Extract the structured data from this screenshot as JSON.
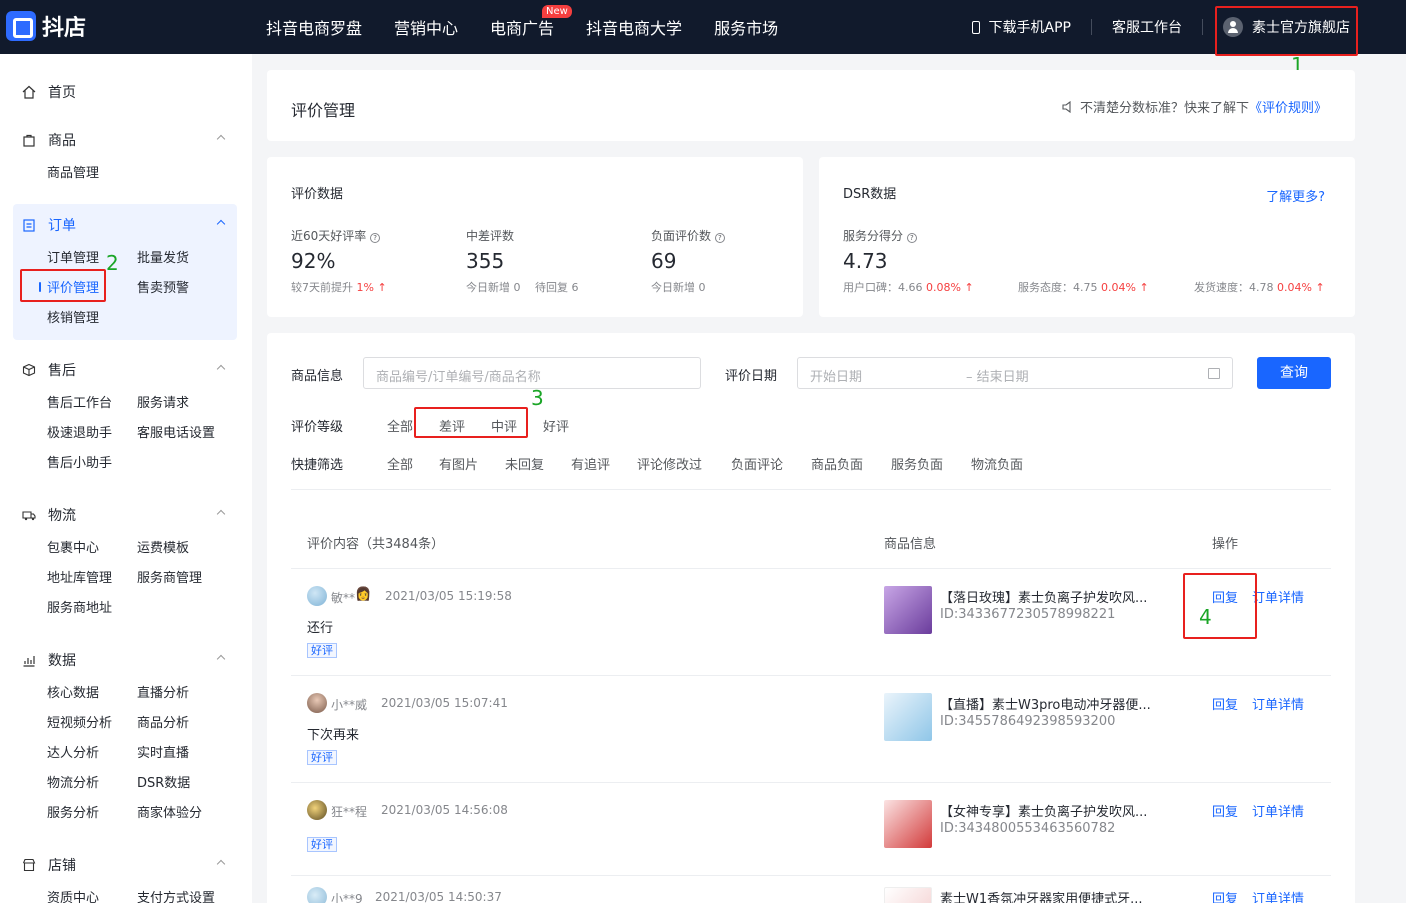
{
  "brand": {
    "name": "抖店"
  },
  "topnav": {
    "items": [
      "抖音电商罗盘",
      "营销中心",
      "电商广告",
      "抖音电商大学",
      "服务市场"
    ],
    "new_badge": "New",
    "download_app": "下载手机APP",
    "service_desk": "客服工作台",
    "shop_name": "素士官方旗舰店"
  },
  "annotations": [
    "1",
    "2",
    "3",
    "4"
  ],
  "sidebar": {
    "home": "首页",
    "sections": [
      {
        "title": "商品",
        "items": [
          "商品管理"
        ]
      },
      {
        "title": "订单",
        "items": [
          "订单管理",
          "批量发货",
          "评价管理",
          "售卖预警",
          "核销管理"
        ]
      },
      {
        "title": "售后",
        "items": [
          "售后工作台",
          "服务请求",
          "极速退助手",
          "客服电话设置",
          "售后小助手"
        ]
      },
      {
        "title": "物流",
        "items": [
          "包裹中心",
          "运费模板",
          "地址库管理",
          "服务商管理",
          "服务商地址"
        ]
      },
      {
        "title": "数据",
        "items": [
          "核心数据",
          "直播分析",
          "短视频分析",
          "商品分析",
          "达人分析",
          "实时直播",
          "物流分析",
          "DSR数据",
          "服务分析",
          "商家体验分"
        ]
      },
      {
        "title": "店铺",
        "items": [
          "资质中心",
          "支付方式设置"
        ]
      }
    ]
  },
  "header": {
    "title": "评价管理",
    "hint": "不清楚分数标准？快来了解下",
    "rules_link": "《评价规则》"
  },
  "review_stats": {
    "title": "评价数据",
    "good_rate_label": "近60天好评率",
    "good_rate": "92%",
    "good_rate_sub": "较7天前提升",
    "good_rate_delta": "1%",
    "mid_bad_label": "中差评数",
    "mid_bad_value": "355",
    "mid_bad_new": "今日新增 0",
    "mid_bad_pending": "待回复 6",
    "negative_label": "负面评价数",
    "negative_value": "69",
    "negative_new": "今日新增 0"
  },
  "dsr": {
    "title": "DSR数据",
    "more_link": "了解更多?",
    "score_label": "服务分得分",
    "score": "4.73",
    "metrics": [
      {
        "label": "用户口碑：4.66",
        "delta": "0.08%"
      },
      {
        "label": "服务态度：4.75",
        "delta": "0.04%"
      },
      {
        "label": "发货速度：4.78",
        "delta": "0.04%"
      }
    ]
  },
  "filters": {
    "product_label": "商品信息",
    "product_placeholder": "商品编号/订单编号/商品名称",
    "date_label": "评价日期",
    "date_start": "开始日期",
    "date_end": "– 结束日期",
    "query_button": "查询",
    "level_label": "评价等级",
    "levels": [
      "全部",
      "差评",
      "中评",
      "好评"
    ],
    "quick_label": "快捷筛选",
    "quick": [
      "全部",
      "有图片",
      "未回复",
      "有追评",
      "评论修改过",
      "负面评论",
      "商品负面",
      "服务负面",
      "物流负面"
    ]
  },
  "table": {
    "col_content": "评价内容（共3484条）",
    "col_product": "商品信息",
    "col_action": "操作",
    "reply": "回复",
    "order_detail": "订单详情",
    "rows": [
      {
        "user": "敏**",
        "time": "2021/03/05 15:19:58",
        "content": "还行",
        "tag": "好评",
        "product": "【落日玫瑰】素士负离子护发吹风...",
        "pid": "ID:3433677230578998221"
      },
      {
        "user": "小**威",
        "time": "2021/03/05 15:07:41",
        "content": "下次再来",
        "tag": "好评",
        "product": "【直播】素士W3pro电动冲牙器便...",
        "pid": "ID:3455786492398593200"
      },
      {
        "user": "狂**程",
        "time": "2021/03/05 14:56:08",
        "content": "",
        "tag": "好评",
        "product": "【女神专享】素士负离子护发吹风...",
        "pid": "ID:3434800553463560782"
      },
      {
        "user": "小**9",
        "time": "2021/03/05 14:50:37",
        "content": "",
        "tag": "",
        "product": "素士W1香氛冲牙器家用便捷式牙...",
        "pid": ""
      }
    ]
  },
  "colors": {
    "accent": "#1966ff",
    "topbar": "#111a2c",
    "up": "#f53f3f",
    "annotation_box": "#e8201e",
    "annotation_num": "#1aa526"
  }
}
